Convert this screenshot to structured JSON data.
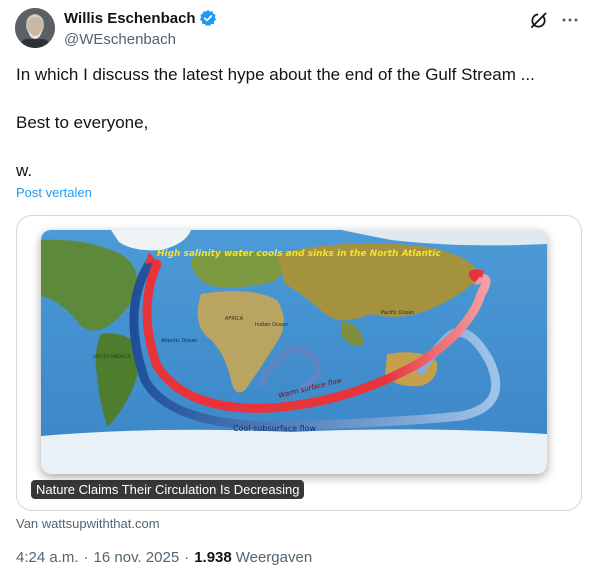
{
  "author": {
    "name": "Willis Eschenbach",
    "handle": "@WEschenbach"
  },
  "tweet": {
    "lines": [
      "In which I discuss the latest hype about the end of the Gulf Stream ...",
      "Best to everyone,",
      "w."
    ],
    "translate_label": "Post vertalen"
  },
  "card": {
    "title": "Nature Claims Their Circulation Is Decreasing",
    "image_labels": {
      "top": "High salinity water cools and sinks in the North Atlantic",
      "warm": "Warm surface flow",
      "cool": "Cool subsurface flow",
      "atlantic": "Atlantic Ocean",
      "indian": "Indian Ocean",
      "pacific": "Pacific Ocean",
      "africa": "AFRICA",
      "south_america": "SOUTH AMERICA"
    },
    "source": "Van wattsupwiththat.com"
  },
  "meta": {
    "time": "4:24 a.m.",
    "separator": "·",
    "date": "16 nov. 2025",
    "views_count": "1.938",
    "views_label": "Weergaven"
  },
  "icons": {
    "verified": "verified-badge-icon",
    "grok": "grok-icon",
    "more": "more-icon"
  },
  "colors": {
    "link": "#1d9bf0",
    "secondary_text": "#536471",
    "primary_text": "#0f1419",
    "warm_flow": "#e8333b",
    "cool_flow": "#2a5fa8",
    "ocean": "#3f8fcf",
    "label_yellow": "#f5e12a"
  }
}
